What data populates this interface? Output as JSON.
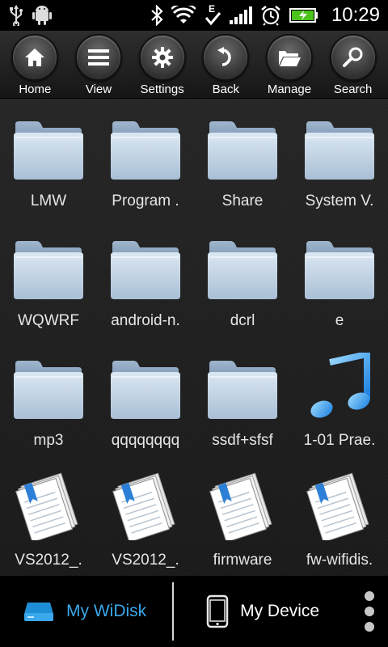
{
  "status_bar": {
    "time": "10:29",
    "icons": [
      "usb-icon",
      "android-debug-icon",
      "bluetooth-icon",
      "wifi-icon",
      "data-e-icon",
      "signal-icon",
      "alarm-icon",
      "battery-charging-icon"
    ]
  },
  "toolbar": {
    "buttons": [
      {
        "label": "Home",
        "icon": "home-icon"
      },
      {
        "label": "View",
        "icon": "list-view-icon"
      },
      {
        "label": "Settings",
        "icon": "gear-icon"
      },
      {
        "label": "Back",
        "icon": "back-arrow-icon"
      },
      {
        "label": "Manage",
        "icon": "folder-open-icon"
      },
      {
        "label": "Search",
        "icon": "search-icon"
      }
    ]
  },
  "files": [
    {
      "label": "LMW",
      "type": "folder"
    },
    {
      "label": "Program .",
      "type": "folder"
    },
    {
      "label": "Share",
      "type": "folder"
    },
    {
      "label": "System V.",
      "type": "folder"
    },
    {
      "label": "WQWRF",
      "type": "folder"
    },
    {
      "label": "android-n.",
      "type": "folder"
    },
    {
      "label": "dcrl",
      "type": "folder"
    },
    {
      "label": "e",
      "type": "folder"
    },
    {
      "label": "mp3",
      "type": "folder"
    },
    {
      "label": "qqqqqqqq",
      "type": "folder"
    },
    {
      "label": "ssdf+sfsf",
      "type": "folder"
    },
    {
      "label": "1-01 Prae.",
      "type": "music"
    },
    {
      "label": "VS2012_.",
      "type": "document"
    },
    {
      "label": "VS2012_.",
      "type": "document"
    },
    {
      "label": "firmware",
      "type": "document"
    },
    {
      "label": "fw-wifidis.",
      "type": "document"
    }
  ],
  "bottom_nav": {
    "widisk_label": "My WiDisk",
    "device_label": "My Device"
  },
  "colors": {
    "accent": "#3aa8ea",
    "folder": "#c6d7e8"
  }
}
